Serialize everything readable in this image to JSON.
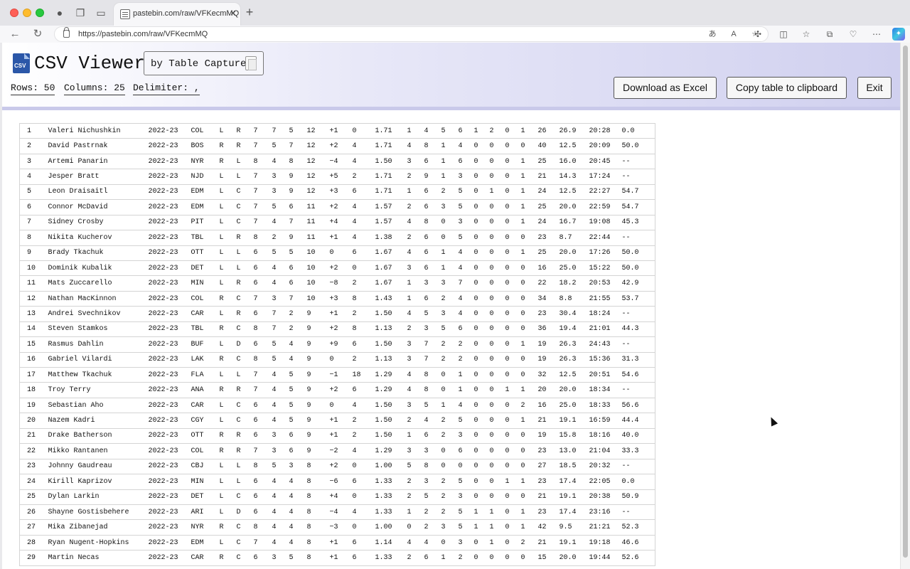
{
  "browser": {
    "tab_title": "pastebin.com/raw/VFKecmMQ",
    "url": "https://pastebin.com/raw/VFKecmMQ"
  },
  "app": {
    "title": "CSV Viewer",
    "byline": "by Table Capture",
    "rows_label": "Rows: 50",
    "columns_label": "Columns: 25",
    "delimiter_label": "Delimiter: ,",
    "download_button": "Download as Excel",
    "copy_button": "Copy table to clipboard",
    "exit_button": "Exit"
  },
  "table": {
    "rows": [
      [
        "1",
        "Valeri Nichushkin",
        "2022-23",
        "COL",
        "L",
        "R",
        "7",
        "7",
        "5",
        "12",
        "+1",
        "0",
        "1.71",
        "1",
        "4",
        "5",
        "6",
        "1",
        "2",
        "0",
        "1",
        "26",
        "26.9",
        "20:28",
        "0.0"
      ],
      [
        "2",
        "David Pastrnak",
        "2022-23",
        "BOS",
        "R",
        "R",
        "7",
        "5",
        "7",
        "12",
        "+2",
        "4",
        "1.71",
        "4",
        "8",
        "1",
        "4",
        "0",
        "0",
        "0",
        "0",
        "40",
        "12.5",
        "20:09",
        "50.0"
      ],
      [
        "3",
        "Artemi Panarin",
        "2022-23",
        "NYR",
        "R",
        "L",
        "8",
        "4",
        "8",
        "12",
        "−4",
        "4",
        "1.50",
        "3",
        "6",
        "1",
        "6",
        "0",
        "0",
        "0",
        "1",
        "25",
        "16.0",
        "20:45",
        "--"
      ],
      [
        "4",
        "Jesper Bratt",
        "2022-23",
        "NJD",
        "L",
        "L",
        "7",
        "3",
        "9",
        "12",
        "+5",
        "2",
        "1.71",
        "2",
        "9",
        "1",
        "3",
        "0",
        "0",
        "0",
        "1",
        "21",
        "14.3",
        "17:24",
        "--"
      ],
      [
        "5",
        "Leon Draisaitl",
        "2022-23",
        "EDM",
        "L",
        "C",
        "7",
        "3",
        "9",
        "12",
        "+3",
        "6",
        "1.71",
        "1",
        "6",
        "2",
        "5",
        "0",
        "1",
        "0",
        "1",
        "24",
        "12.5",
        "22:27",
        "54.7"
      ],
      [
        "6",
        "Connor McDavid",
        "2022-23",
        "EDM",
        "L",
        "C",
        "7",
        "5",
        "6",
        "11",
        "+2",
        "4",
        "1.57",
        "2",
        "6",
        "3",
        "5",
        "0",
        "0",
        "0",
        "1",
        "25",
        "20.0",
        "22:59",
        "54.7"
      ],
      [
        "7",
        "Sidney Crosby",
        "2022-23",
        "PIT",
        "L",
        "C",
        "7",
        "4",
        "7",
        "11",
        "+4",
        "4",
        "1.57",
        "4",
        "8",
        "0",
        "3",
        "0",
        "0",
        "0",
        "1",
        "24",
        "16.7",
        "19:08",
        "45.3"
      ],
      [
        "8",
        "Nikita Kucherov",
        "2022-23",
        "TBL",
        "L",
        "R",
        "8",
        "2",
        "9",
        "11",
        "+1",
        "4",
        "1.38",
        "2",
        "6",
        "0",
        "5",
        "0",
        "0",
        "0",
        "0",
        "23",
        "8.7",
        "22:44",
        "--"
      ],
      [
        "9",
        "Brady Tkachuk",
        "2022-23",
        "OTT",
        "L",
        "L",
        "6",
        "5",
        "5",
        "10",
        "0",
        "6",
        "1.67",
        "4",
        "6",
        "1",
        "4",
        "0",
        "0",
        "0",
        "1",
        "25",
        "20.0",
        "17:26",
        "50.0"
      ],
      [
        "10",
        "Dominik Kubalik",
        "2022-23",
        "DET",
        "L",
        "L",
        "6",
        "4",
        "6",
        "10",
        "+2",
        "0",
        "1.67",
        "3",
        "6",
        "1",
        "4",
        "0",
        "0",
        "0",
        "0",
        "16",
        "25.0",
        "15:22",
        "50.0"
      ],
      [
        "11",
        "Mats Zuccarello",
        "2022-23",
        "MIN",
        "L",
        "R",
        "6",
        "4",
        "6",
        "10",
        "−8",
        "2",
        "1.67",
        "1",
        "3",
        "3",
        "7",
        "0",
        "0",
        "0",
        "0",
        "22",
        "18.2",
        "20:53",
        "42.9"
      ],
      [
        "12",
        "Nathan MacKinnon",
        "2022-23",
        "COL",
        "R",
        "C",
        "7",
        "3",
        "7",
        "10",
        "+3",
        "8",
        "1.43",
        "1",
        "6",
        "2",
        "4",
        "0",
        "0",
        "0",
        "0",
        "34",
        "8.8",
        "21:55",
        "53.7"
      ],
      [
        "13",
        "Andrei Svechnikov",
        "2022-23",
        "CAR",
        "L",
        "R",
        "6",
        "7",
        "2",
        "9",
        "+1",
        "2",
        "1.50",
        "4",
        "5",
        "3",
        "4",
        "0",
        "0",
        "0",
        "0",
        "23",
        "30.4",
        "18:24",
        "--"
      ],
      [
        "14",
        "Steven Stamkos",
        "2022-23",
        "TBL",
        "R",
        "C",
        "8",
        "7",
        "2",
        "9",
        "+2",
        "8",
        "1.13",
        "2",
        "3",
        "5",
        "6",
        "0",
        "0",
        "0",
        "0",
        "36",
        "19.4",
        "21:01",
        "44.3"
      ],
      [
        "15",
        "Rasmus Dahlin",
        "2022-23",
        "BUF",
        "L",
        "D",
        "6",
        "5",
        "4",
        "9",
        "+9",
        "6",
        "1.50",
        "3",
        "7",
        "2",
        "2",
        "0",
        "0",
        "0",
        "1",
        "19",
        "26.3",
        "24:43",
        "--"
      ],
      [
        "16",
        "Gabriel Vilardi",
        "2022-23",
        "LAK",
        "R",
        "C",
        "8",
        "5",
        "4",
        "9",
        "0",
        "2",
        "1.13",
        "3",
        "7",
        "2",
        "2",
        "0",
        "0",
        "0",
        "0",
        "19",
        "26.3",
        "15:36",
        "31.3"
      ],
      [
        "17",
        "Matthew Tkachuk",
        "2022-23",
        "FLA",
        "L",
        "L",
        "7",
        "4",
        "5",
        "9",
        "−1",
        "18",
        "1.29",
        "4",
        "8",
        "0",
        "1",
        "0",
        "0",
        "0",
        "0",
        "32",
        "12.5",
        "20:51",
        "54.6"
      ],
      [
        "18",
        "Troy Terry",
        "2022-23",
        "ANA",
        "R",
        "R",
        "7",
        "4",
        "5",
        "9",
        "+2",
        "6",
        "1.29",
        "4",
        "8",
        "0",
        "1",
        "0",
        "0",
        "1",
        "1",
        "20",
        "20.0",
        "18:34",
        "--"
      ],
      [
        "19",
        "Sebastian Aho",
        "2022-23",
        "CAR",
        "L",
        "C",
        "6",
        "4",
        "5",
        "9",
        "0",
        "4",
        "1.50",
        "3",
        "5",
        "1",
        "4",
        "0",
        "0",
        "0",
        "2",
        "16",
        "25.0",
        "18:33",
        "56.6"
      ],
      [
        "20",
        "Nazem Kadri",
        "2022-23",
        "CGY",
        "L",
        "C",
        "6",
        "4",
        "5",
        "9",
        "+1",
        "2",
        "1.50",
        "2",
        "4",
        "2",
        "5",
        "0",
        "0",
        "0",
        "1",
        "21",
        "19.1",
        "16:59",
        "44.4"
      ],
      [
        "21",
        "Drake Batherson",
        "2022-23",
        "OTT",
        "R",
        "R",
        "6",
        "3",
        "6",
        "9",
        "+1",
        "2",
        "1.50",
        "1",
        "6",
        "2",
        "3",
        "0",
        "0",
        "0",
        "0",
        "19",
        "15.8",
        "18:16",
        "40.0"
      ],
      [
        "22",
        "Mikko Rantanen",
        "2022-23",
        "COL",
        "R",
        "R",
        "7",
        "3",
        "6",
        "9",
        "−2",
        "4",
        "1.29",
        "3",
        "3",
        "0",
        "6",
        "0",
        "0",
        "0",
        "0",
        "23",
        "13.0",
        "21:04",
        "33.3"
      ],
      [
        "23",
        "Johnny Gaudreau",
        "2022-23",
        "CBJ",
        "L",
        "L",
        "8",
        "5",
        "3",
        "8",
        "+2",
        "0",
        "1.00",
        "5",
        "8",
        "0",
        "0",
        "0",
        "0",
        "0",
        "0",
        "27",
        "18.5",
        "20:32",
        "--"
      ],
      [
        "24",
        "Kirill Kaprizov",
        "2022-23",
        "MIN",
        "L",
        "L",
        "6",
        "4",
        "4",
        "8",
        "−6",
        "6",
        "1.33",
        "2",
        "3",
        "2",
        "5",
        "0",
        "0",
        "1",
        "1",
        "23",
        "17.4",
        "22:05",
        "0.0"
      ],
      [
        "25",
        "Dylan Larkin",
        "2022-23",
        "DET",
        "L",
        "C",
        "6",
        "4",
        "4",
        "8",
        "+4",
        "0",
        "1.33",
        "2",
        "5",
        "2",
        "3",
        "0",
        "0",
        "0",
        "0",
        "21",
        "19.1",
        "20:38",
        "50.9"
      ],
      [
        "26",
        "Shayne Gostisbehere",
        "2022-23",
        "ARI",
        "L",
        "D",
        "6",
        "4",
        "4",
        "8",
        "−4",
        "4",
        "1.33",
        "1",
        "2",
        "2",
        "5",
        "1",
        "1",
        "0",
        "1",
        "23",
        "17.4",
        "23:16",
        "--"
      ],
      [
        "27",
        "Mika Zibanejad",
        "2022-23",
        "NYR",
        "R",
        "C",
        "8",
        "4",
        "4",
        "8",
        "−3",
        "0",
        "1.00",
        "0",
        "2",
        "3",
        "5",
        "1",
        "1",
        "0",
        "1",
        "42",
        "9.5",
        "21:21",
        "52.3"
      ],
      [
        "28",
        "Ryan Nugent-Hopkins",
        "2022-23",
        "EDM",
        "L",
        "C",
        "7",
        "4",
        "4",
        "8",
        "+1",
        "6",
        "1.14",
        "4",
        "4",
        "0",
        "3",
        "0",
        "1",
        "0",
        "2",
        "21",
        "19.1",
        "19:18",
        "46.6"
      ],
      [
        "29",
        "Martin Necas",
        "2022-23",
        "CAR",
        "R",
        "C",
        "6",
        "3",
        "5",
        "8",
        "+1",
        "6",
        "1.33",
        "2",
        "6",
        "1",
        "2",
        "0",
        "0",
        "0",
        "0",
        "15",
        "20.0",
        "19:44",
        "52.6"
      ]
    ]
  }
}
